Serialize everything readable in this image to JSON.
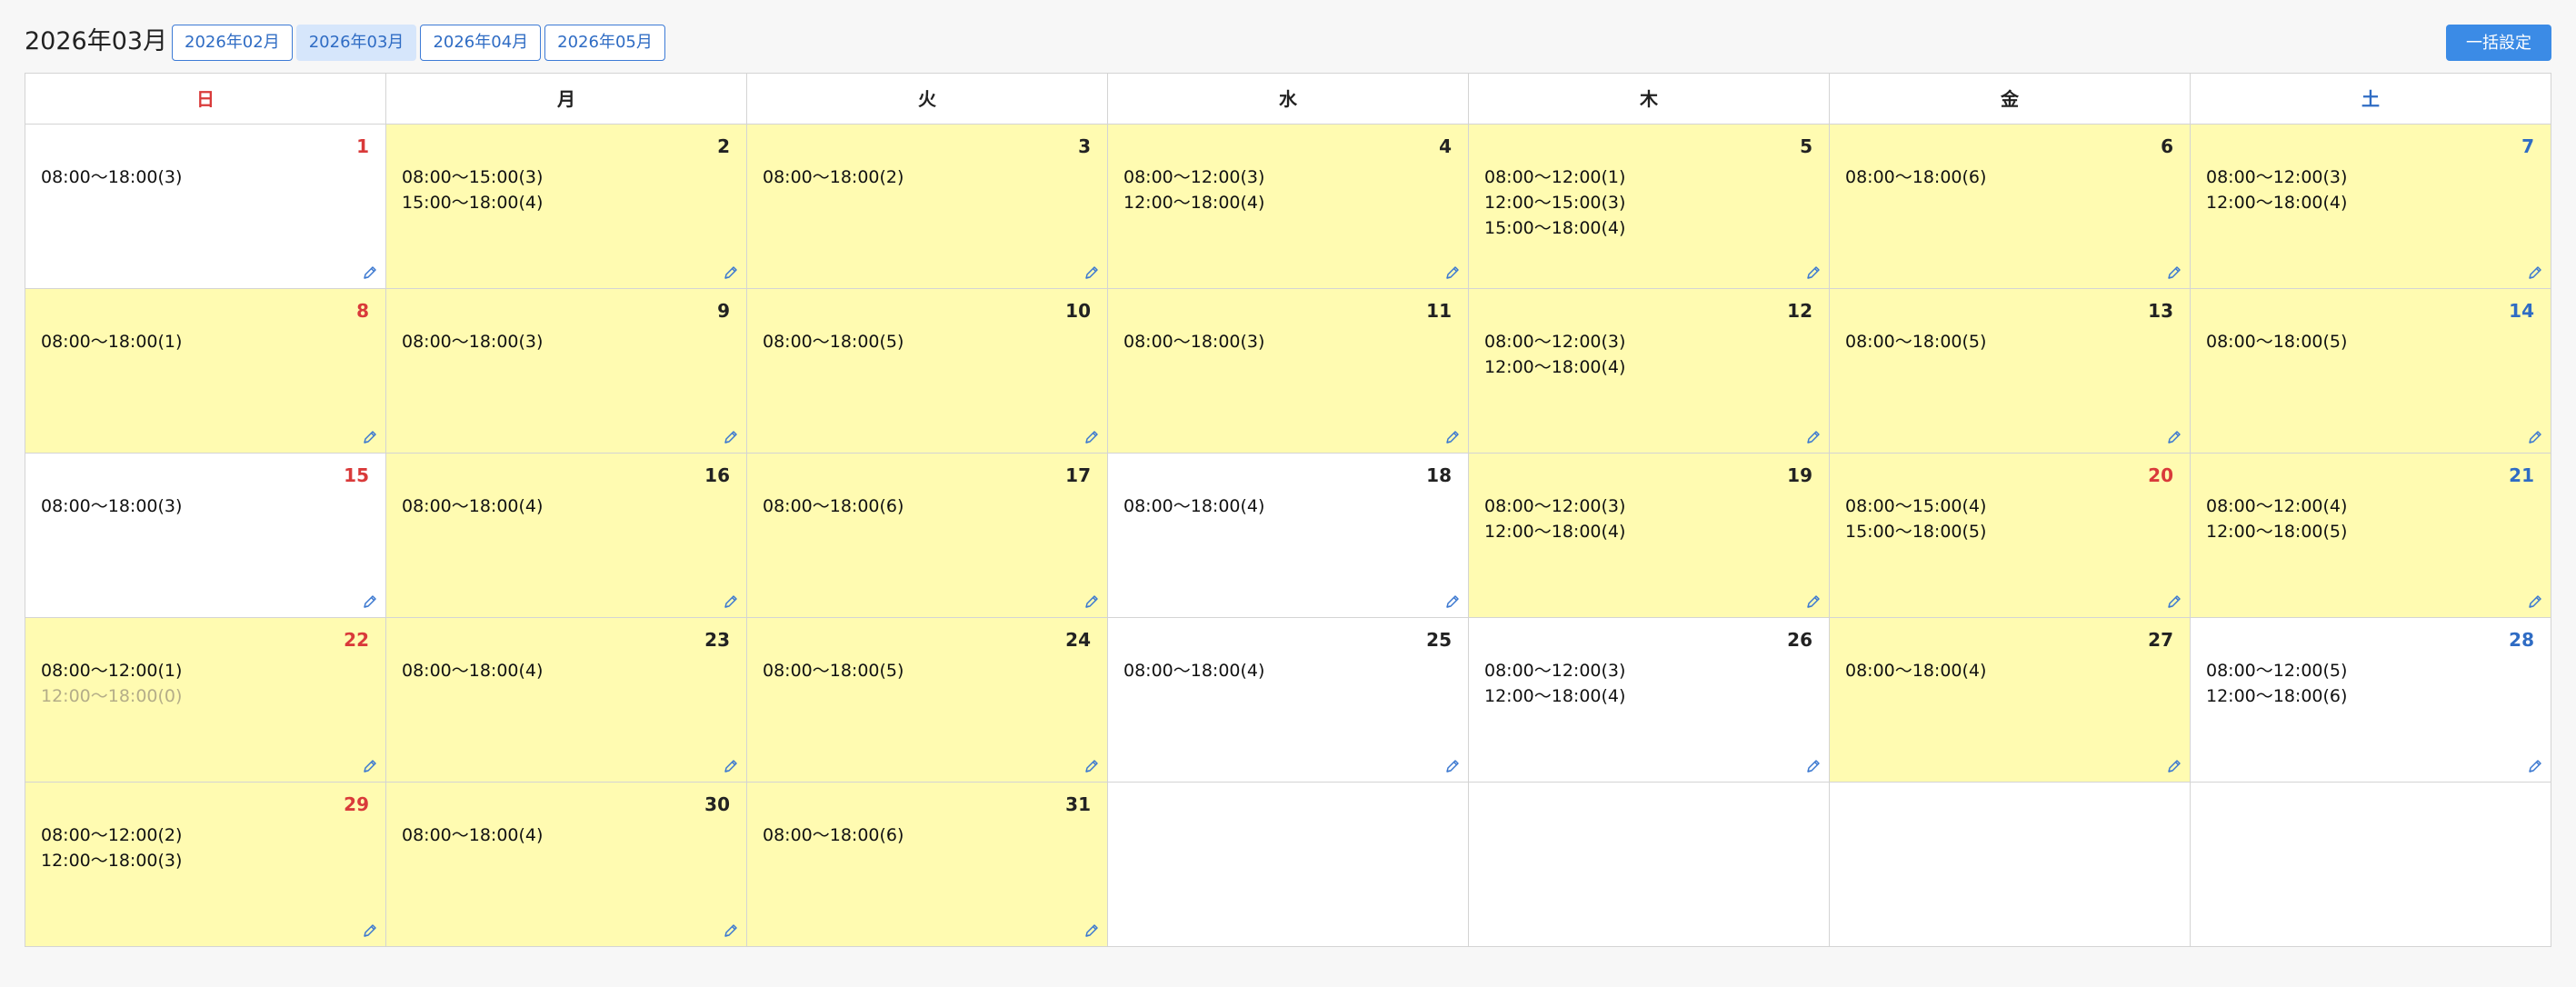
{
  "header": {
    "title": "2026年03月",
    "months": [
      {
        "label": "2026年02月",
        "active": false
      },
      {
        "label": "2026年03月",
        "active": true
      },
      {
        "label": "2026年04月",
        "active": false
      },
      {
        "label": "2026年05月",
        "active": false
      }
    ],
    "bulk_button": "一括設定"
  },
  "weekdays": [
    "日",
    "月",
    "火",
    "水",
    "木",
    "金",
    "土"
  ],
  "colors": {
    "highlight": "#fffbb1",
    "sunday": "#d93a3a",
    "saturday": "#2f6cc4",
    "accent": "#3b8be6"
  },
  "weeks": [
    [
      {
        "day": "1",
        "hl": false,
        "slots": [
          {
            "t": "08:00〜18:00(3)"
          }
        ]
      },
      {
        "day": "2",
        "hl": true,
        "slots": [
          {
            "t": "08:00〜15:00(3)"
          },
          {
            "t": "15:00〜18:00(4)"
          }
        ]
      },
      {
        "day": "3",
        "hl": true,
        "slots": [
          {
            "t": "08:00〜18:00(2)"
          }
        ]
      },
      {
        "day": "4",
        "hl": true,
        "slots": [
          {
            "t": "08:00〜12:00(3)"
          },
          {
            "t": "12:00〜18:00(4)"
          }
        ]
      },
      {
        "day": "5",
        "hl": true,
        "slots": [
          {
            "t": "08:00〜12:00(1)"
          },
          {
            "t": "12:00〜15:00(3)"
          },
          {
            "t": "15:00〜18:00(4)"
          }
        ]
      },
      {
        "day": "6",
        "hl": true,
        "slots": [
          {
            "t": "08:00〜18:00(6)"
          }
        ]
      },
      {
        "day": "7",
        "hl": true,
        "slots": [
          {
            "t": "08:00〜12:00(3)"
          },
          {
            "t": "12:00〜18:00(4)"
          }
        ]
      }
    ],
    [
      {
        "day": "8",
        "hl": true,
        "slots": [
          {
            "t": "08:00〜18:00(1)"
          }
        ]
      },
      {
        "day": "9",
        "hl": true,
        "slots": [
          {
            "t": "08:00〜18:00(3)"
          }
        ]
      },
      {
        "day": "10",
        "hl": true,
        "slots": [
          {
            "t": "08:00〜18:00(5)"
          }
        ]
      },
      {
        "day": "11",
        "hl": true,
        "slots": [
          {
            "t": "08:00〜18:00(3)"
          }
        ]
      },
      {
        "day": "12",
        "hl": true,
        "slots": [
          {
            "t": "08:00〜12:00(3)"
          },
          {
            "t": "12:00〜18:00(4)"
          }
        ]
      },
      {
        "day": "13",
        "hl": true,
        "slots": [
          {
            "t": "08:00〜18:00(5)"
          }
        ]
      },
      {
        "day": "14",
        "hl": true,
        "slots": [
          {
            "t": "08:00〜18:00(5)"
          }
        ]
      }
    ],
    [
      {
        "day": "15",
        "hl": false,
        "slots": [
          {
            "t": "08:00〜18:00(3)"
          }
        ]
      },
      {
        "day": "16",
        "hl": true,
        "slots": [
          {
            "t": "08:00〜18:00(4)"
          }
        ]
      },
      {
        "day": "17",
        "hl": true,
        "slots": [
          {
            "t": "08:00〜18:00(6)"
          }
        ]
      },
      {
        "day": "18",
        "hl": false,
        "slots": [
          {
            "t": "08:00〜18:00(4)"
          }
        ]
      },
      {
        "day": "19",
        "hl": true,
        "slots": [
          {
            "t": "08:00〜12:00(3)"
          },
          {
            "t": "12:00〜18:00(4)"
          }
        ]
      },
      {
        "day": "20",
        "hl": true,
        "holiday": true,
        "slots": [
          {
            "t": "08:00〜15:00(4)"
          },
          {
            "t": "15:00〜18:00(5)"
          }
        ]
      },
      {
        "day": "21",
        "hl": true,
        "slots": [
          {
            "t": "08:00〜12:00(4)"
          },
          {
            "t": "12:00〜18:00(5)"
          }
        ]
      }
    ],
    [
      {
        "day": "22",
        "hl": true,
        "slots": [
          {
            "t": "08:00〜12:00(1)"
          },
          {
            "t": "12:00〜18:00(0)",
            "muted": true
          }
        ]
      },
      {
        "day": "23",
        "hl": true,
        "slots": [
          {
            "t": "08:00〜18:00(4)"
          }
        ]
      },
      {
        "day": "24",
        "hl": true,
        "slots": [
          {
            "t": "08:00〜18:00(5)"
          }
        ]
      },
      {
        "day": "25",
        "hl": false,
        "slots": [
          {
            "t": "08:00〜18:00(4)"
          }
        ]
      },
      {
        "day": "26",
        "hl": false,
        "slots": [
          {
            "t": "08:00〜12:00(3)"
          },
          {
            "t": "12:00〜18:00(4)"
          }
        ]
      },
      {
        "day": "27",
        "hl": true,
        "slots": [
          {
            "t": "08:00〜18:00(4)"
          }
        ]
      },
      {
        "day": "28",
        "hl": false,
        "slots": [
          {
            "t": "08:00〜12:00(5)"
          },
          {
            "t": "12:00〜18:00(6)"
          }
        ]
      }
    ],
    [
      {
        "day": "29",
        "hl": true,
        "slots": [
          {
            "t": "08:00〜12:00(2)"
          },
          {
            "t": "12:00〜18:00(3)"
          }
        ]
      },
      {
        "day": "30",
        "hl": true,
        "slots": [
          {
            "t": "08:00〜18:00(4)"
          }
        ]
      },
      {
        "day": "31",
        "hl": true,
        "slots": [
          {
            "t": "08:00〜18:00(6)"
          }
        ]
      },
      null,
      null,
      null,
      null
    ]
  ]
}
